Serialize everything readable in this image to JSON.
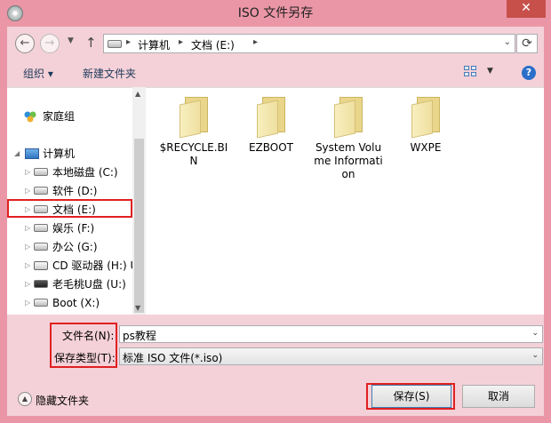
{
  "window": {
    "title": "ISO 文件另存",
    "close_glyph": "✕"
  },
  "navigation": {
    "back_glyph": "←",
    "forward_glyph": "→",
    "recent_glyph": "▼",
    "up_glyph": "↑",
    "refresh_glyph": "⟳",
    "breadcrumb": [
      "计算机",
      "文档 (E:)"
    ],
    "crumb_separator": "▸",
    "address_dropdown_glyph": "⌄"
  },
  "toolbar": {
    "organize_label": "组织 ▾",
    "new_folder_label": "新建文件夹",
    "view_dropdown_glyph": "▼",
    "help_glyph": "?"
  },
  "nav_pane": {
    "homegroup": "家庭组",
    "computer": "计算机",
    "drives": [
      {
        "label": "本地磁盘 (C:)",
        "icon": "hard-drive-icon"
      },
      {
        "label": "软件 (D:)",
        "icon": "hard-drive-icon"
      },
      {
        "label": "文档 (E:)",
        "icon": "hard-drive-icon",
        "selected": true
      },
      {
        "label": "娱乐 (F:)",
        "icon": "hard-drive-icon"
      },
      {
        "label": "办公 (G:)",
        "icon": "hard-drive-icon"
      },
      {
        "label": "CD 驱动器 (H:) U",
        "icon": "cd-drive-icon"
      },
      {
        "label": "老毛桃U盘 (U:)",
        "icon": "usb-drive-icon"
      },
      {
        "label": "Boot (X:)",
        "icon": "hard-drive-icon"
      }
    ],
    "expand_glyph": "▷",
    "expanded_glyph": "◢"
  },
  "folders": [
    "$RECYCLE.BIN",
    "EZBOOT",
    "System Volume Information",
    "WXPE"
  ],
  "save_form": {
    "filename_label": "文件名(N):",
    "filename_value": "ps教程",
    "filetype_label": "保存类型(T):",
    "filetype_value": "标准 ISO 文件(*.iso)",
    "dropdown_glyph": "⌄"
  },
  "footer": {
    "hide_folders_label": "隐藏文件夹",
    "hide_glyph": "▲",
    "save_label": "保存(S)",
    "cancel_label": "取消"
  },
  "colors": {
    "frame": "#ea96a6",
    "chrome": "#f4d1d8",
    "highlight_box": "#e02020"
  }
}
